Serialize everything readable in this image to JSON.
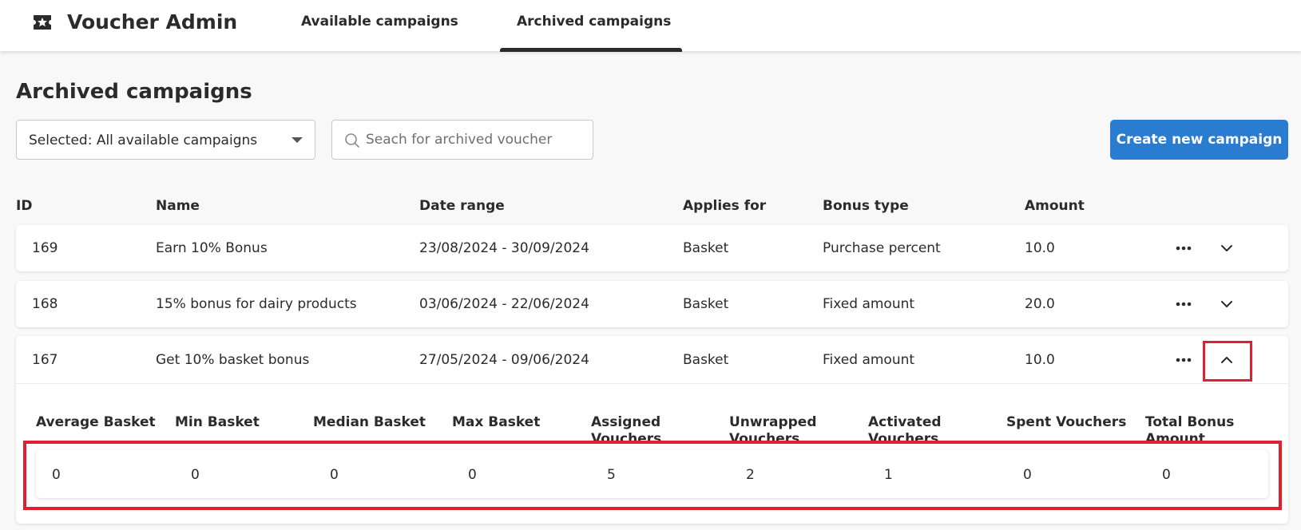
{
  "app": {
    "title": "Voucher Admin",
    "icon": "ticket-star-icon"
  },
  "nav": {
    "tabs": [
      {
        "label": "Available campaigns",
        "active": false
      },
      {
        "label": "Archived campaigns",
        "active": true
      }
    ]
  },
  "page": {
    "title": "Archived campaigns"
  },
  "filter": {
    "selected_label": "Selected: All available campaigns"
  },
  "search": {
    "placeholder": "Seach for archived voucher",
    "value": ""
  },
  "actions": {
    "create_label": "Create new campaign"
  },
  "table": {
    "columns": [
      "ID",
      "Name",
      "Date range",
      "Applies for",
      "Bonus type",
      "Amount"
    ],
    "rows": [
      {
        "id": "169",
        "name": "Earn 10% Bonus",
        "date_range": "23/08/2024 - 30/09/2024",
        "applies_for": "Basket",
        "bonus_type": "Purchase percent",
        "amount": "10.0",
        "expanded": false
      },
      {
        "id": "168",
        "name": "15% bonus for dairy products",
        "date_range": "03/06/2024 - 22/06/2024",
        "applies_for": "Basket",
        "bonus_type": "Fixed amount",
        "amount": "20.0",
        "expanded": false
      },
      {
        "id": "167",
        "name": "Get 10% basket bonus",
        "date_range": "27/05/2024 - 09/06/2024",
        "applies_for": "Basket",
        "bonus_type": "Fixed amount",
        "amount": "10.0",
        "expanded": true
      }
    ]
  },
  "details": {
    "headers": [
      "Average Basket",
      "Min Basket",
      "Median Basket",
      "Max Basket",
      "Assigned Vouchers",
      "Unwrapped Vouchers",
      "Activated Vouchers",
      "Spent Vouchers",
      "Total Bonus Amount"
    ],
    "values": [
      "0",
      "0",
      "0",
      "0",
      "5",
      "2",
      "1",
      "0",
      "0"
    ]
  },
  "colors": {
    "primary": "#2a7cd0",
    "highlight": "#e0202e",
    "text": "#2b2b2b",
    "background": "#f8f8f8"
  }
}
